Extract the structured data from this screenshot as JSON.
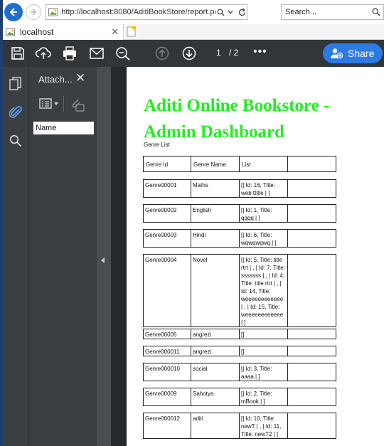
{
  "browser": {
    "url": "http://localhost:8080/AditiBookStore/report.pdf?role=adn",
    "search_placeholder": "Search...",
    "tab_title": "localhost"
  },
  "pdf_toolbar": {
    "page_current": "1",
    "page_total": "/ 2",
    "more": "•••",
    "share_label": "Share"
  },
  "attachments_panel": {
    "title": "Attach...",
    "column_header": "Name"
  },
  "document": {
    "title_line1": "Aditi Online Bookstore -",
    "title_line2": "Admin Dashboard",
    "subtitle": "Genre List",
    "headers": [
      "Genre Id",
      "Genre Name",
      "List",
      ""
    ],
    "rows": [
      {
        "id": "Genre00001",
        "name": "Maths",
        "list": "[| Id: 16, Title: web ttitle | ]"
      },
      {
        "id": "Genre00002",
        "name": "English",
        "list": "[| Id: 1, Title: qqqq | ]"
      },
      {
        "id": "Genre00003",
        "name": "Hindi",
        "list": "[| Id: 6, Title: wqwqwqwq | ]"
      },
      {
        "id": "Genre00004",
        "name": "Novel",
        "list": "[| Id: 5, Title: title rtrt | , | Id: 7, Title: sssssss | , | Id: 4, Title: title rtrt | , | Id: 14, Title: weeeeeeeeeeee | , | Id: 15, Title: weeeeeeeeeeee | ]"
      },
      {
        "id": "Genre00005",
        "name": "angrezi",
        "list": "[]"
      },
      {
        "id": "Genre000011",
        "name": "angrezi",
        "list": "[]"
      },
      {
        "id": "Genre000010",
        "name": "social",
        "list": "[| Id: 3, Title: aaaa | ]"
      },
      {
        "id": "Genre00009",
        "name": "Sahotya",
        "list": "[| Id: 2, Title: mBook | ]"
      },
      {
        "id": "Genre000012",
        "name": "aditi",
        "list": "[| Id: 10, Title: newT | , | Id: 11, Title: newT2 | ]"
      }
    ]
  },
  "colors": {
    "accent_blue": "#2c7be5",
    "title_green": "#22ee22",
    "toolbar_dark": "#323639",
    "panel_gray": "#3b3f43"
  },
  "icons": [
    "back-arrow-icon",
    "forward-arrow-icon",
    "page-favicon",
    "dropdown-icon",
    "refresh-icon",
    "search-icon",
    "save-icon",
    "upload-icon",
    "print-icon",
    "mail-icon",
    "zoom-out-icon",
    "page-up-icon",
    "page-down-icon",
    "share-person-icon",
    "pages-icon",
    "attachment-icon",
    "find-icon",
    "list-options-icon",
    "attach-disabled-icon",
    "new-tab-icon"
  ]
}
